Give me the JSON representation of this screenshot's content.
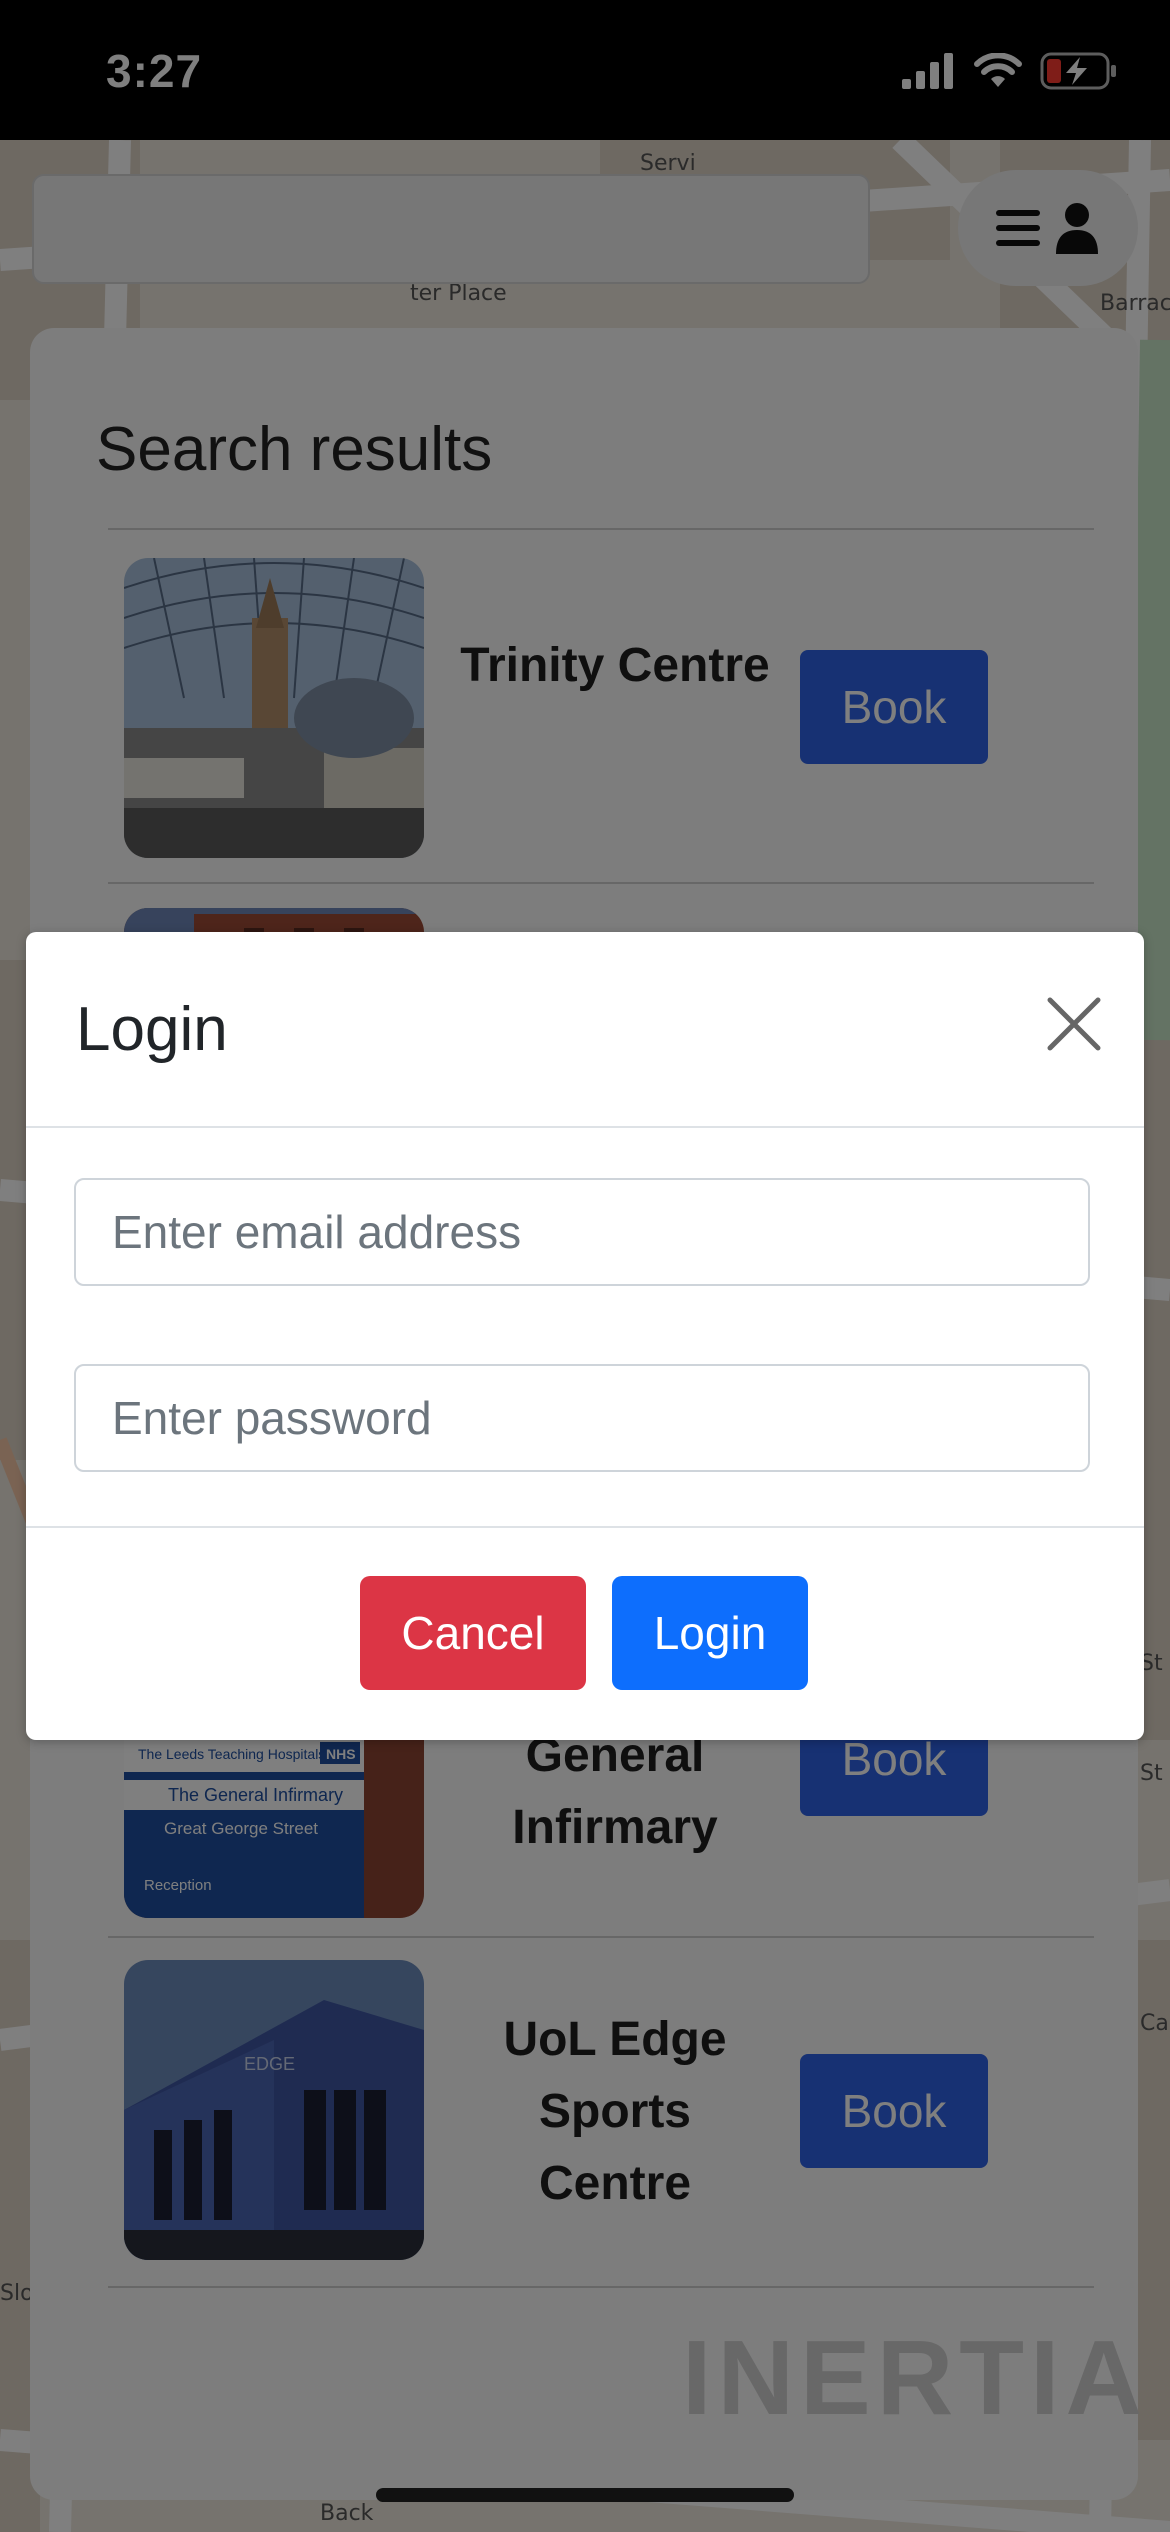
{
  "status_bar": {
    "time": "3:27"
  },
  "header": {
    "menu_icon": "hamburger-menu-icon",
    "user_icon": "user-icon"
  },
  "map": {
    "street_labels": [
      "Servi",
      "ter Place",
      "Barrac",
      "St",
      "St",
      "Ca",
      "Slo",
      "Back"
    ]
  },
  "results": {
    "title": "Search results",
    "items": [
      {
        "name": "Trinity Centre",
        "button": "Book"
      },
      {
        "name": "General Infirmary",
        "button": "Book",
        "sign_lines": [
          "The Leeds Teaching Hospitals",
          "NHS",
          "The General Infirmary",
          "Great George Street",
          "Reception"
        ]
      },
      {
        "name": "UoL Edge Sports Centre",
        "button": "Book",
        "building_sign": "EDGE"
      }
    ],
    "watermark": "INERTIA"
  },
  "modal": {
    "title": "Login",
    "email_placeholder": "Enter email address",
    "password_placeholder": "Enter password",
    "cancel_label": "Cancel",
    "login_label": "Login"
  },
  "colors": {
    "book": "#2f62e6",
    "cancel": "#dc3545",
    "login": "#0d6efd"
  }
}
